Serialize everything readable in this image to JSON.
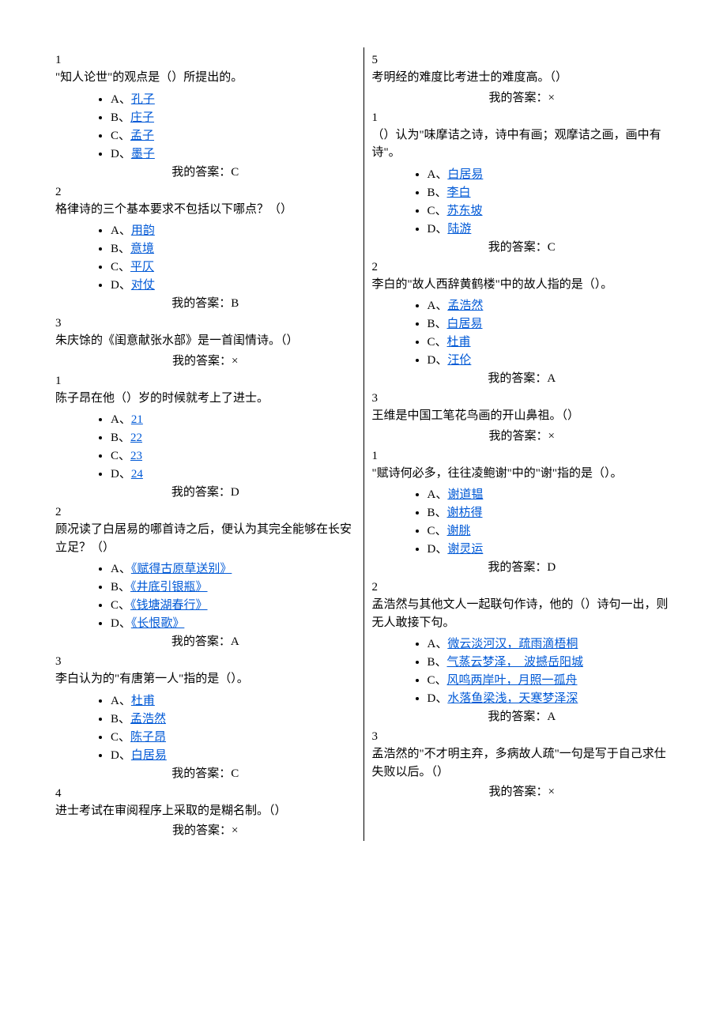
{
  "answer_prefix": "我的答案：",
  "left": {
    "q1": {
      "num": "1",
      "stem": "\"知人论世\"的观点是（）所提出的。",
      "A": "A、",
      "A_link": "孔子",
      "B": "B、",
      "B_link": "庄子",
      "C": "C、",
      "C_link": "孟子",
      "D": "D、",
      "D_link": "墨子",
      "ans": "C"
    },
    "q2": {
      "num": "2",
      "stem": "格律诗的三个基本要求不包括以下哪点？（）",
      "A": "A、",
      "A_link": "用韵",
      "B": "B、",
      "B_link": "意境",
      "C": "C、",
      "C_link": "平仄",
      "D": "D、",
      "D_link": "对仗",
      "ans": "B"
    },
    "q3": {
      "num": "3",
      "stem": "朱庆馀的《闺意献张水部》是一首闺情诗。（）",
      "ans": "×"
    },
    "q4": {
      "num": "1",
      "stem": "陈子昂在他（）岁的时候就考上了进士。",
      "A": "A、",
      "A_link": "21",
      "B": "B、",
      "B_link": "22",
      "C": "C、",
      "C_link": "23",
      "D": "D、",
      "D_link": "24",
      "ans": "D"
    },
    "q5": {
      "num": "2",
      "stem": "顾况读了白居易的哪首诗之后，便认为其完全能够在长安立足？（）",
      "A": "A、",
      "A_link": "《赋得古原草送别》",
      "B": "B、",
      "B_link": "《井底引银瓶》",
      "C": "C、",
      "C_link": "《钱塘湖春行》",
      "D": "D、",
      "D_link": "《长恨歌》",
      "ans": "A"
    },
    "q6": {
      "num": "3",
      "stem": "李白认为的\"有唐第一人\"指的是（）。",
      "A": "A、",
      "A_link": "杜甫",
      "B": "B、",
      "B_link": "孟浩然",
      "C": "C、",
      "C_link": "陈子昂",
      "D": "D、",
      "D_link": "白居易",
      "ans": "C"
    },
    "q7": {
      "num": "4",
      "stem": "进士考试在审阅程序上采取的是糊名制。（）",
      "ans": "×"
    }
  },
  "right": {
    "q1": {
      "num": "5",
      "stem": "考明经的难度比考进士的难度高。（）",
      "ans": "×"
    },
    "q2": {
      "num": "1",
      "stem": "（）认为\"味摩诘之诗，诗中有画；观摩诘之画，画中有诗\"。",
      "A": "A、",
      "A_link": "白居易",
      "B": "B、",
      "B_link": "李白",
      "C": "C、",
      "C_link": "苏东坡",
      "D": "D、",
      "D_link": "陆游",
      "ans": "C"
    },
    "q3": {
      "num": "2",
      "stem": "李白的\"故人西辞黄鹤楼\"中的故人指的是（）。",
      "A": "A、",
      "A_link": "孟浩然",
      "B": "B、",
      "B_link": "白居易",
      "C": "C、",
      "C_link": "杜甫",
      "D": "D、",
      "D_link": "汪伦",
      "ans": "A"
    },
    "q4": {
      "num": "3",
      "stem": "王维是中国工笔花鸟画的开山鼻祖。（）",
      "ans": "×"
    },
    "q5": {
      "num": "1",
      "stem": "\"赋诗何必多，往往凌鲍谢\"中的\"谢\"指的是（）。",
      "A": "A、",
      "A_link": "谢道韫",
      "B": "B、",
      "B_link": "谢枋得",
      "C": "C、",
      "C_link": "谢朓",
      "D": "D、",
      "D_link": "谢灵运",
      "ans": "D"
    },
    "q6": {
      "num": "2",
      "stem": "孟浩然与其他文人一起联句作诗，他的（）诗句一出，则无人敢接下句。",
      "A": "A、",
      "A_link": "微云淡河汉，疏雨滴梧桐",
      "B": "B、",
      "B_link": "气蒸云梦泽，　波撼岳阳城",
      "C": "C、",
      "C_link": "风鸣两岸叶，月照一孤舟",
      "D": "D、",
      "D_link": "水落鱼梁浅，天寒梦泽深",
      "ans": "A"
    },
    "q7": {
      "num": "3",
      "stem": "孟浩然的\"不才明主弃，多病故人疏\"一句是写于自己求仕失败以后。（）",
      "ans": "×"
    }
  }
}
